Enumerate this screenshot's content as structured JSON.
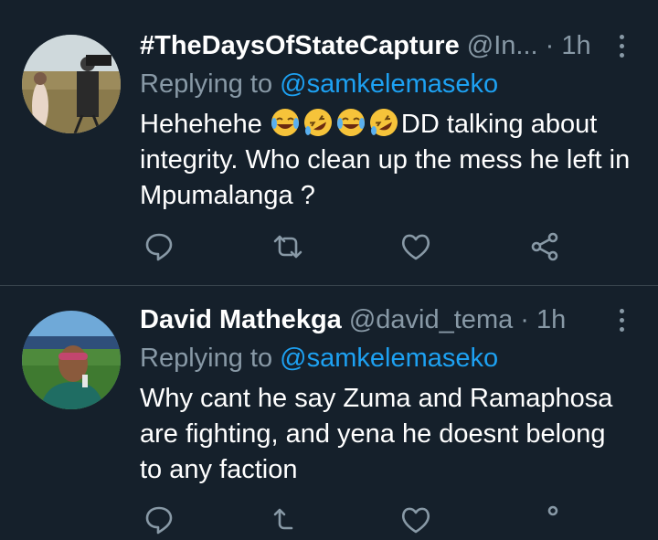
{
  "tweets": [
    {
      "name": "#TheDaysOfStateCapture",
      "handle": "@In...",
      "dot": " · ",
      "time": "1h",
      "replying_prefix": "Replying to ",
      "replying_to": "@samkelemaseko",
      "text_before_emoji": "Hehehehe ",
      "emojis": [
        "face-with-tears-of-joy",
        "rolling-on-the-floor-laughing",
        "face-with-tears-of-joy",
        "rolling-on-the-floor-laughing"
      ],
      "text_after_emoji": "DD talking about integrity. Who clean up the mess he left in Mpumalanga ?"
    },
    {
      "name": "David Mathekga",
      "handle": "@david_tema",
      "dot": " · ",
      "time": "1h",
      "replying_prefix": "Replying to ",
      "replying_to": "@samkelemaseko",
      "text": "Why cant he say Zuma and Ramaphosa are fighting, and yena he doesnt belong to any faction"
    }
  ],
  "actions": [
    "reply-icon",
    "retweet-icon",
    "like-icon",
    "share-icon"
  ],
  "colors": {
    "background": "#15202b",
    "secondary_text": "#8899a6",
    "mention": "#1da1f2",
    "divider": "#38444d"
  }
}
